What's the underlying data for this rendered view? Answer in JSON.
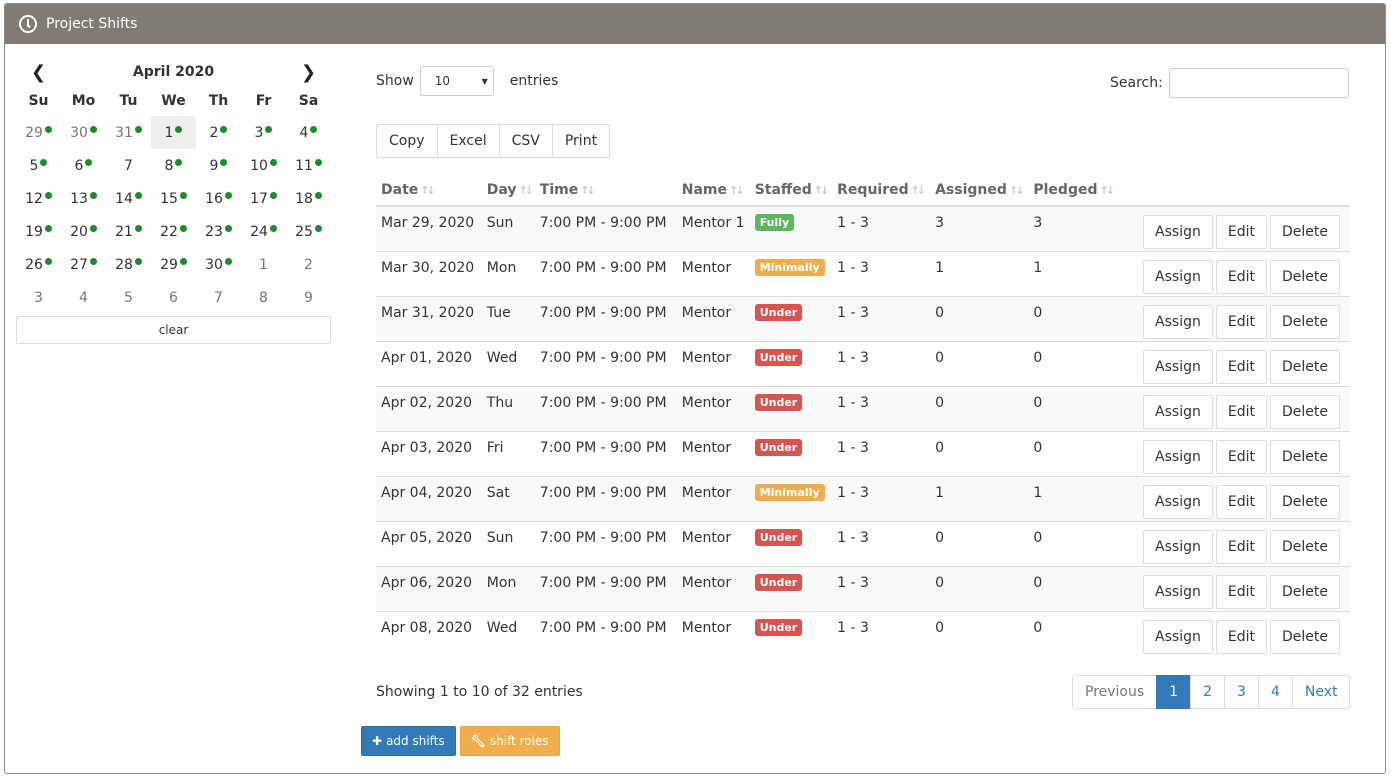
{
  "panel": {
    "title": "Project Shifts",
    "icon": "clock-icon"
  },
  "calendar": {
    "title": "April 2020",
    "prev_icon": "chevron-left-icon",
    "next_icon": "chevron-right-icon",
    "dow": [
      "Su",
      "Mo",
      "Tu",
      "We",
      "Th",
      "Fr",
      "Sa"
    ],
    "days": [
      {
        "n": "29",
        "cls": "old",
        "dot": true
      },
      {
        "n": "30",
        "cls": "old",
        "dot": true
      },
      {
        "n": "31",
        "cls": "old",
        "dot": true
      },
      {
        "n": "1",
        "cls": "active",
        "dot": true
      },
      {
        "n": "2",
        "cls": "",
        "dot": true
      },
      {
        "n": "3",
        "cls": "",
        "dot": true
      },
      {
        "n": "4",
        "cls": "",
        "dot": true
      },
      {
        "n": "5",
        "cls": "",
        "dot": true
      },
      {
        "n": "6",
        "cls": "",
        "dot": true
      },
      {
        "n": "7",
        "cls": "",
        "dot": false
      },
      {
        "n": "8",
        "cls": "",
        "dot": true
      },
      {
        "n": "9",
        "cls": "",
        "dot": true
      },
      {
        "n": "10",
        "cls": "",
        "dot": true
      },
      {
        "n": "11",
        "cls": "",
        "dot": true
      },
      {
        "n": "12",
        "cls": "",
        "dot": true
      },
      {
        "n": "13",
        "cls": "",
        "dot": true
      },
      {
        "n": "14",
        "cls": "",
        "dot": true
      },
      {
        "n": "15",
        "cls": "",
        "dot": true
      },
      {
        "n": "16",
        "cls": "",
        "dot": true
      },
      {
        "n": "17",
        "cls": "",
        "dot": true
      },
      {
        "n": "18",
        "cls": "",
        "dot": true
      },
      {
        "n": "19",
        "cls": "",
        "dot": true
      },
      {
        "n": "20",
        "cls": "",
        "dot": true
      },
      {
        "n": "21",
        "cls": "",
        "dot": true
      },
      {
        "n": "22",
        "cls": "",
        "dot": true
      },
      {
        "n": "23",
        "cls": "",
        "dot": true
      },
      {
        "n": "24",
        "cls": "",
        "dot": true
      },
      {
        "n": "25",
        "cls": "",
        "dot": true
      },
      {
        "n": "26",
        "cls": "",
        "dot": true
      },
      {
        "n": "27",
        "cls": "",
        "dot": true
      },
      {
        "n": "28",
        "cls": "",
        "dot": true
      },
      {
        "n": "29",
        "cls": "",
        "dot": true
      },
      {
        "n": "30",
        "cls": "",
        "dot": true
      },
      {
        "n": "1",
        "cls": "new",
        "dot": false
      },
      {
        "n": "2",
        "cls": "new",
        "dot": false
      },
      {
        "n": "3",
        "cls": "new",
        "dot": false
      },
      {
        "n": "4",
        "cls": "new",
        "dot": false
      },
      {
        "n": "5",
        "cls": "new",
        "dot": false
      },
      {
        "n": "6",
        "cls": "new",
        "dot": false
      },
      {
        "n": "7",
        "cls": "new",
        "dot": false
      },
      {
        "n": "8",
        "cls": "new",
        "dot": false
      },
      {
        "n": "9",
        "cls": "new",
        "dot": false
      }
    ],
    "clear_label": "clear"
  },
  "controls": {
    "show_label": "Show",
    "length_value": "10",
    "entries_label": "entries",
    "search_label": "Search:",
    "search_value": ""
  },
  "export": [
    "Copy",
    "Excel",
    "CSV",
    "Print"
  ],
  "table": {
    "headers": [
      "Date",
      "Day",
      "Time",
      "Name",
      "Staffed",
      "Required",
      "Assigned",
      "Pledged"
    ],
    "rows": [
      {
        "date": "Mar 29, 2020",
        "day": "Sun",
        "time": "7:00 PM - 9:00 PM",
        "name": "Mentor 1",
        "staffed": "Fully",
        "status": "fully",
        "required": "1 - 3",
        "assigned": "3",
        "pledged": "3"
      },
      {
        "date": "Mar 30, 2020",
        "day": "Mon",
        "time": "7:00 PM - 9:00 PM",
        "name": "Mentor",
        "staffed": "Minimally",
        "status": "minimally",
        "required": "1 - 3",
        "assigned": "1",
        "pledged": "1"
      },
      {
        "date": "Mar 31, 2020",
        "day": "Tue",
        "time": "7:00 PM - 9:00 PM",
        "name": "Mentor",
        "staffed": "Under",
        "status": "under",
        "required": "1 - 3",
        "assigned": "0",
        "pledged": "0"
      },
      {
        "date": "Apr 01, 2020",
        "day": "Wed",
        "time": "7:00 PM - 9:00 PM",
        "name": "Mentor",
        "staffed": "Under",
        "status": "under",
        "required": "1 - 3",
        "assigned": "0",
        "pledged": "0"
      },
      {
        "date": "Apr 02, 2020",
        "day": "Thu",
        "time": "7:00 PM - 9:00 PM",
        "name": "Mentor",
        "staffed": "Under",
        "status": "under",
        "required": "1 - 3",
        "assigned": "0",
        "pledged": "0"
      },
      {
        "date": "Apr 03, 2020",
        "day": "Fri",
        "time": "7:00 PM - 9:00 PM",
        "name": "Mentor",
        "staffed": "Under",
        "status": "under",
        "required": "1 - 3",
        "assigned": "0",
        "pledged": "0"
      },
      {
        "date": "Apr 04, 2020",
        "day": "Sat",
        "time": "7:00 PM - 9:00 PM",
        "name": "Mentor",
        "staffed": "Minimally",
        "status": "minimally",
        "required": "1 - 3",
        "assigned": "1",
        "pledged": "1"
      },
      {
        "date": "Apr 05, 2020",
        "day": "Sun",
        "time": "7:00 PM - 9:00 PM",
        "name": "Mentor",
        "staffed": "Under",
        "status": "under",
        "required": "1 - 3",
        "assigned": "0",
        "pledged": "0"
      },
      {
        "date": "Apr 06, 2020",
        "day": "Mon",
        "time": "7:00 PM - 9:00 PM",
        "name": "Mentor",
        "staffed": "Under",
        "status": "under",
        "required": "1 - 3",
        "assigned": "0",
        "pledged": "0"
      },
      {
        "date": "Apr 08, 2020",
        "day": "Wed",
        "time": "7:00 PM - 9:00 PM",
        "name": "Mentor",
        "staffed": "Under",
        "status": "under",
        "required": "1 - 3",
        "assigned": "0",
        "pledged": "0"
      }
    ],
    "actions": {
      "assign": "Assign",
      "edit": "Edit",
      "delete": "Delete"
    }
  },
  "info": "Showing 1 to 10 of 32 entries",
  "pagination": {
    "previous": "Previous",
    "pages": [
      "1",
      "2",
      "3",
      "4"
    ],
    "active": "1",
    "next": "Next"
  },
  "bottom": {
    "add_shifts": "add shifts",
    "add_icon": "plus-icon",
    "shift_roles": "shift roles",
    "roles_icon": "wrench-icon"
  },
  "colors": {
    "header_bg": "#807c73",
    "primary": "#337ab7",
    "warning": "#f0ad4e",
    "danger": "#d9534f",
    "success": "#5cb85c",
    "dot": "#1e8a2e"
  }
}
